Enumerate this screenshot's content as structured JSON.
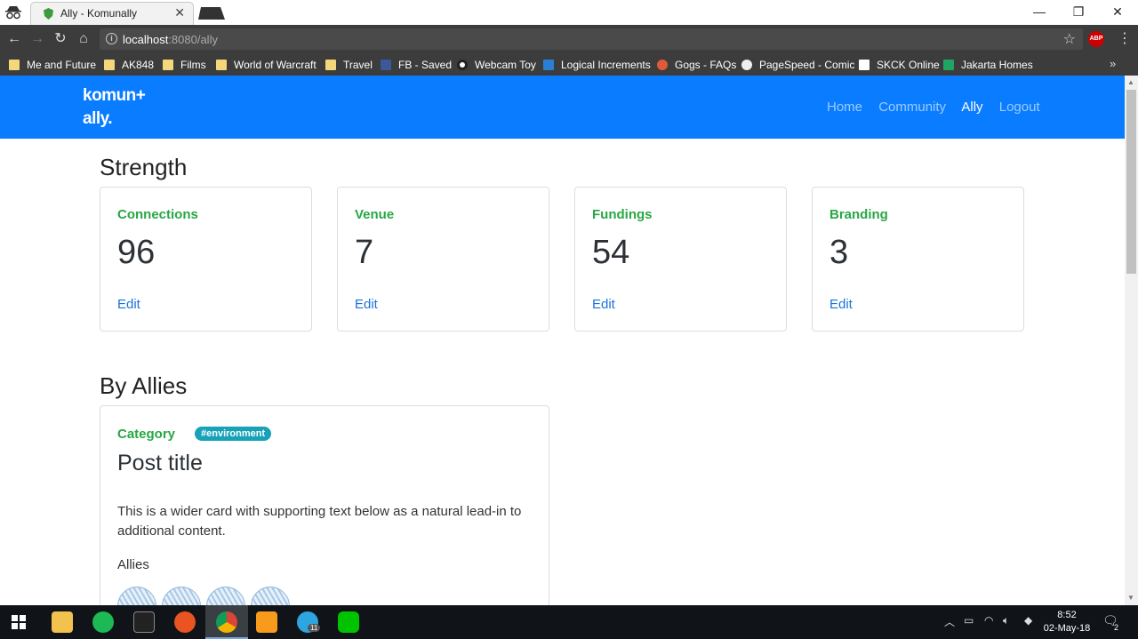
{
  "browser": {
    "tab_title": "Ally - Komunally",
    "url_host": "localhost",
    "url_rest": ":8080/ally",
    "bookmarks": [
      "Me and Future",
      "AK848",
      "Films",
      "World of Warcraft",
      "Travel",
      "FB - Saved",
      "Webcam Toy",
      "Logical Increments",
      "Gogs - FAQs",
      "PageSpeed - Comic",
      "SKCK Online",
      "Jakarta Homes"
    ],
    "abp_label": "ABP"
  },
  "site": {
    "brand_line1": "komun+",
    "brand_line2": "ally.",
    "nav": [
      "Home",
      "Community",
      "Ally",
      "Logout"
    ],
    "active_nav": "Ally"
  },
  "strength": {
    "heading": "Strength",
    "cards": [
      {
        "label": "Connections",
        "value": "96",
        "edit": "Edit"
      },
      {
        "label": "Venue",
        "value": "7",
        "edit": "Edit"
      },
      {
        "label": "Fundings",
        "value": "54",
        "edit": "Edit"
      },
      {
        "label": "Branding",
        "value": "3",
        "edit": "Edit"
      }
    ]
  },
  "allies_section": {
    "heading": "By Allies",
    "post": {
      "category": "Category",
      "tag": "#environment",
      "title": "Post title",
      "text": "This is a wider card with supporting text below as a natural lead-in to additional content.",
      "allies_label": "Allies"
    }
  },
  "taskbar": {
    "time": "8:52",
    "date": "02-May-18",
    "notification_count": "2",
    "telegram_badge": "11"
  },
  "colors": {
    "navbar": "#0a7cff",
    "label_green": "#28a745",
    "link_blue": "#1a73d9",
    "tag_teal": "#17a2b8"
  }
}
